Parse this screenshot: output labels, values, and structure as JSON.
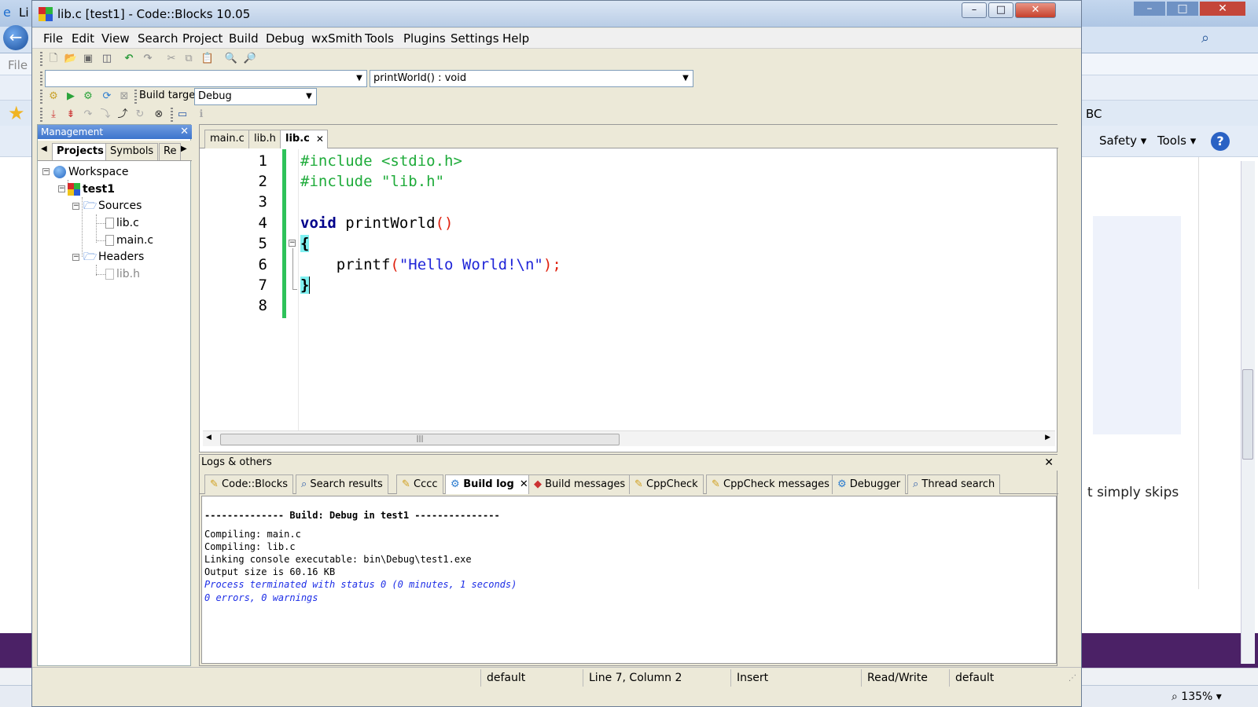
{
  "background": {
    "title_frag": "Li",
    "file_menu": "File",
    "address_search_placeholder": "",
    "bc_text": "BC",
    "safety": "Safety",
    "tools": "Tools",
    "help": "?",
    "content_text": "t simply skips",
    "zoom": "135%"
  },
  "window": {
    "title": "lib.c [test1] - Code::Blocks 10.05",
    "minimize": "–",
    "maximize": "□",
    "close": "✕"
  },
  "menu": [
    "File",
    "Edit",
    "View",
    "Search",
    "Project",
    "Build",
    "Debug",
    "wxSmith",
    "Tools",
    "Plugins",
    "Settings",
    "Help"
  ],
  "toolbar": {
    "scope_combo": "",
    "function_combo": "printWorld() : void",
    "build_target_label": "Build target:",
    "build_target_value": "Debug"
  },
  "management": {
    "title": "Management",
    "tabs": [
      "Projects",
      "Symbols",
      "Re"
    ],
    "tree": {
      "workspace": "Workspace",
      "project": "test1",
      "sources": "Sources",
      "sources_files": [
        "lib.c",
        "main.c"
      ],
      "headers": "Headers",
      "headers_files": [
        "lib.h"
      ]
    }
  },
  "editor": {
    "tabs": [
      "main.c",
      "lib.h",
      "lib.c"
    ],
    "active_tab": "lib.c",
    "line_numbers": [
      "1",
      "2",
      "3",
      "4",
      "5",
      "6",
      "7",
      "8"
    ],
    "code": {
      "l1": "#include <stdio.h>",
      "l2": "#include \"lib.h\"",
      "l4_kw": "void",
      "l4_name": " printWorld",
      "l4_paren": "()",
      "l5": "{",
      "l6_fn": "    printf",
      "l6_open": "(",
      "l6_str": "\"Hello World!\\n\"",
      "l6_close": ");",
      "l7": "}"
    }
  },
  "logs": {
    "title": "Logs & others",
    "tabs": [
      "Code::Blocks",
      "Search results",
      "Cccc",
      "Build log",
      "Build messages",
      "CppCheck",
      "CppCheck messages",
      "Debugger",
      "Thread search"
    ],
    "active_tab": "Build log",
    "lines": [
      "-------------- Build: Debug in test1 ---------------",
      "",
      "Compiling: main.c",
      "Compiling: lib.c",
      "Linking console executable: bin\\Debug\\test1.exe",
      "Output size is 60.16 KB"
    ],
    "info_lines": [
      "Process terminated with status 0 (0 minutes, 1 seconds)",
      "0 errors, 0 warnings"
    ]
  },
  "status": {
    "encoding": "default",
    "position": "Line 7, Column 2",
    "mode": "Insert",
    "access": "Read/Write",
    "lang": "default"
  }
}
